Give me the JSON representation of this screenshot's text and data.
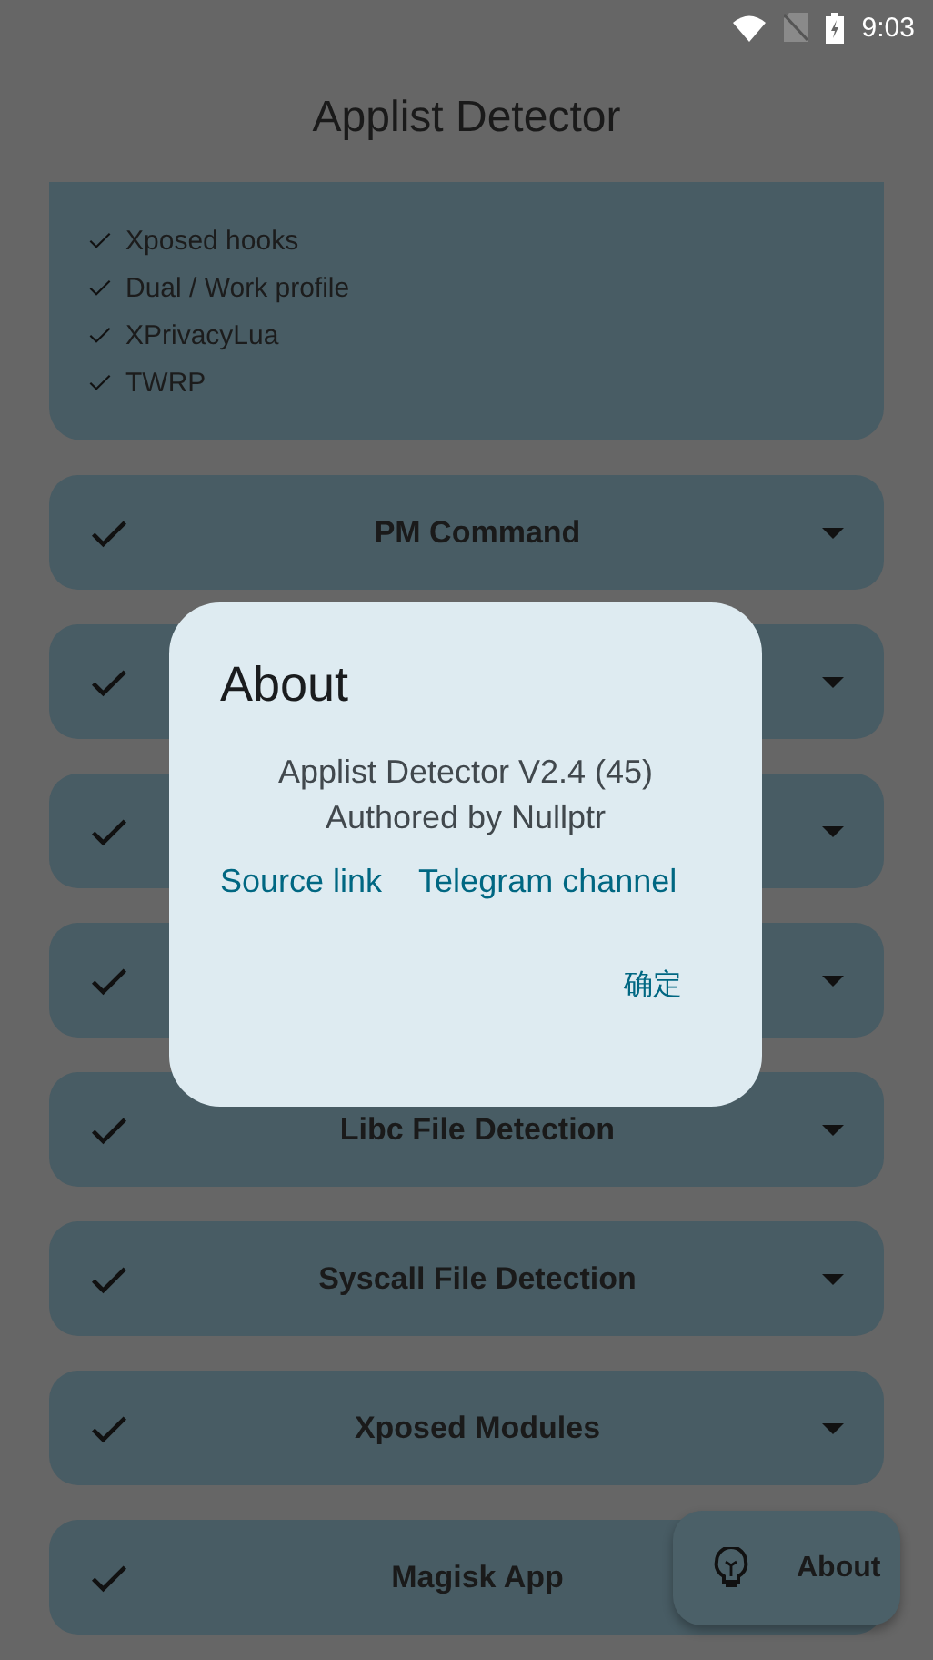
{
  "status_bar": {
    "time": "9:03"
  },
  "app_bar": {
    "title": "Applist Detector"
  },
  "summary_card": {
    "items": [
      {
        "label": "Xposed hooks",
        "checked": true
      },
      {
        "label": "Dual / Work profile",
        "checked": true
      },
      {
        "label": "XPrivacyLua",
        "checked": true
      },
      {
        "label": "TWRP",
        "checked": true
      }
    ]
  },
  "detections": [
    {
      "label": "PM Command",
      "checked": true,
      "arrow": true
    },
    {
      "checked": true,
      "arrow": true
    },
    {
      "checked": true,
      "arrow": true
    },
    {
      "checked": true,
      "arrow": true
    },
    {
      "label": "Libc File Detection",
      "checked": true,
      "arrow": true
    },
    {
      "label": "Syscall File Detection",
      "checked": true,
      "arrow": true
    },
    {
      "label": "Xposed Modules",
      "checked": true,
      "arrow": true
    },
    {
      "label": "Magisk App",
      "checked": true,
      "arrow": false
    }
  ],
  "fab": {
    "label": "About"
  },
  "dialog": {
    "title": "About",
    "lines": [
      "Applist Detector V2.4 (45)",
      "Authored by Nullptr"
    ],
    "links": [
      "Source link",
      "Telegram channel"
    ],
    "button": "确定"
  }
}
